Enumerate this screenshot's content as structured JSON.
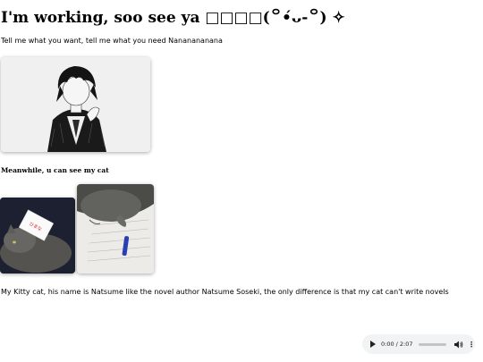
{
  "header": {
    "title": "I'm working, soo see ya □□□□(꒪•́ᴗ-꒪) ✧",
    "subtitle": "Tell me what you want, tell me what you need Nananananana"
  },
  "section": {
    "heading": "Meanwhile, u can see my cat"
  },
  "images": {
    "artwork": "anime-character-drawing",
    "cat_1": "cat-photo-with-card",
    "cat_2": "cat-photo-with-pen",
    "card_text": "ひまな"
  },
  "caption": "My Kitty cat, his name is Natsume like the novel author Natsume Soseki, the only difference is that my cat can't write novels",
  "audio": {
    "time": "0:00 / 2:07",
    "progress": 0,
    "volume": 0.6,
    "icons": [
      "play-icon",
      "volume-icon",
      "more-options-icon"
    ]
  }
}
